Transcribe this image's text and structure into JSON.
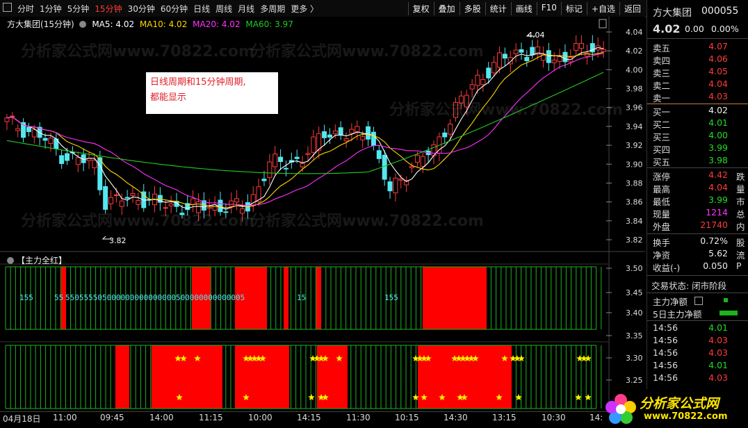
{
  "toolbar": {
    "periods": [
      "分时",
      "1分钟",
      "5分钟",
      "15分钟",
      "30分钟",
      "60分钟",
      "日线",
      "周线",
      "月线",
      "多周期",
      "更多 〉"
    ],
    "active_period": "15分钟",
    "tools": [
      "复权",
      "叠加",
      "多股",
      "统计",
      "画线",
      "F10",
      "标记",
      "+自选",
      "返回"
    ]
  },
  "title": {
    "stock": "方大集团",
    "period": "(15分钟)",
    "ma5": "MA5: 4.02",
    "ma10": "MA10: 4.02",
    "ma20": "MA20: 4.02",
    "ma60": "MA60: 3.97"
  },
  "annotation": {
    "line1": "日线周期和15分钟周期,",
    "line2": "都能显示"
  },
  "indicator": {
    "name": "【主力全红】"
  },
  "markers": {
    "high": "4.04",
    "low": "3.82"
  },
  "axis": {
    "price_ticks": [
      "4.04",
      "4.02",
      "4.00",
      "3.98",
      "3.96",
      "3.94",
      "3.92",
      "3.90",
      "3.88",
      "3.86",
      "3.84",
      "3.82"
    ],
    "ind_ticks": [
      "3.50",
      "3.45",
      "3.40",
      "3.35",
      "3.30",
      "3.25"
    ],
    "dates": [
      "04月18日",
      "11:00",
      "09:45",
      "14:00",
      "11:15",
      "10:00",
      "14:15",
      "11:30",
      "10:15",
      "14:30",
      "13:15",
      "10:30",
      "14:"
    ]
  },
  "digits_text": {
    "a": "155",
    "b": "55",
    "c": "550555505000000000000000500000000000005",
    "d": "15",
    "e": "155"
  },
  "quote": {
    "name": "方大集团",
    "code": "000055",
    "price": "4.02",
    "change": "0.00",
    "pct": "0.00%",
    "asks": [
      {
        "label": "卖五",
        "price": "4.07"
      },
      {
        "label": "卖四",
        "price": "4.06"
      },
      {
        "label": "卖三",
        "price": "4.05"
      },
      {
        "label": "卖二",
        "price": "4.04"
      },
      {
        "label": "卖一",
        "price": "4.03"
      }
    ],
    "bids": [
      {
        "label": "买一",
        "price": "4.02"
      },
      {
        "label": "买二",
        "price": "4.01"
      },
      {
        "label": "买三",
        "price": "4.00"
      },
      {
        "label": "买四",
        "price": "3.99"
      },
      {
        "label": "买五",
        "price": "3.98"
      }
    ],
    "stats": [
      {
        "label": "涨停",
        "value": "4.42",
        "extra": "跌"
      },
      {
        "label": "最高",
        "value": "4.04",
        "extra": "量"
      },
      {
        "label": "最低",
        "value": "3.99",
        "extra": "市"
      },
      {
        "label": "现量",
        "value": "1214",
        "extra": "总"
      },
      {
        "label": "外盘",
        "value": "21740",
        "extra": "内"
      }
    ],
    "fin": [
      {
        "label": "换手",
        "value": "0.72%",
        "extra": "股"
      },
      {
        "label": "净资",
        "value": "5.62",
        "extra": "流"
      },
      {
        "label": "收益(-)",
        "value": "0.050",
        "extra": "P"
      }
    ],
    "trade_status": "交易状态: 闭市阶段",
    "flow1": "主力净额",
    "flow2": "5日主力净额",
    "ticks": [
      {
        "time": "14:56",
        "price": "4.01"
      },
      {
        "time": "14:56",
        "price": "4.03"
      },
      {
        "time": "14:56",
        "price": "4.03"
      },
      {
        "time": "14:56",
        "price": "4.01"
      },
      {
        "time": "14:56",
        "price": "4.03"
      }
    ]
  },
  "logo": {
    "text": "分析家公式网",
    "url": "www.70822.com"
  },
  "watermark": "分析家公式网www.70822.com",
  "colors": {
    "up": "#ff3b3b",
    "down": "#54e8f0",
    "ma5": "#ffffff",
    "ma10": "#ffd700",
    "ma20": "#ff33ff",
    "ma60": "#22cc22",
    "bar_red": "#ff0000",
    "bar_green": "#1db31d"
  }
}
